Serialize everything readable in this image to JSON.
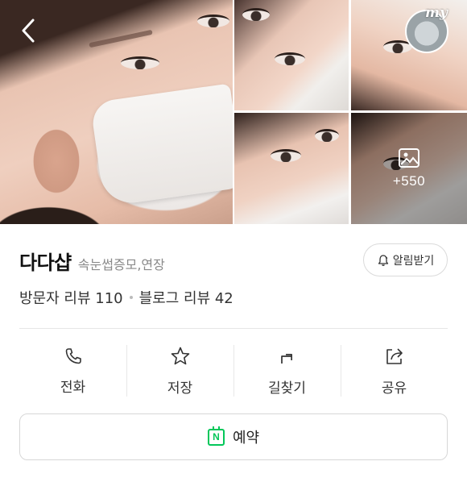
{
  "gallery": {
    "more_photos_count": "+550",
    "profile_label": "my"
  },
  "place": {
    "name": "다다샵",
    "category": "속눈썹증모,연장",
    "alert_label": "알림받기"
  },
  "reviews": {
    "visitor_label": "방문자 리뷰 110",
    "blog_label": "블로그 리뷰 42"
  },
  "actions": [
    {
      "label": "전화",
      "icon": "phone-icon"
    },
    {
      "label": "저장",
      "icon": "star-icon"
    },
    {
      "label": "길찾기",
      "icon": "directions-icon"
    },
    {
      "label": "공유",
      "icon": "share-icon"
    }
  ],
  "reserve": {
    "label": "예약",
    "badge": "N",
    "accent_color": "#03c75a"
  }
}
